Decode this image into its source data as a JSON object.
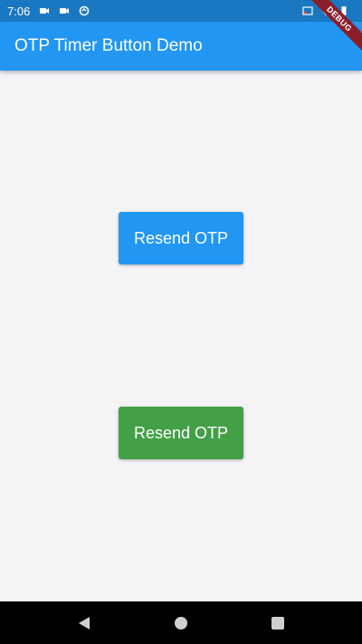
{
  "status_bar": {
    "time": "7:06",
    "icons": [
      "video-camera-icon",
      "video-camera-icon",
      "sync-icon",
      "cast-icon",
      "wifi-icon",
      "battery-icon"
    ]
  },
  "app_bar": {
    "title": "OTP Timer Button Demo"
  },
  "debug_banner": "DEBUG",
  "buttons": [
    {
      "label": "Resend OTP",
      "color": "#2196f3"
    },
    {
      "label": "Resend OTP",
      "color": "#43a047"
    }
  ],
  "nav_bar": {
    "icons": [
      "back-icon",
      "home-icon",
      "recents-icon"
    ]
  },
  "colors": {
    "primary": "#2196f3",
    "status_bar": "#1a78c2",
    "green": "#43a047",
    "background": "#f4f3f6"
  }
}
